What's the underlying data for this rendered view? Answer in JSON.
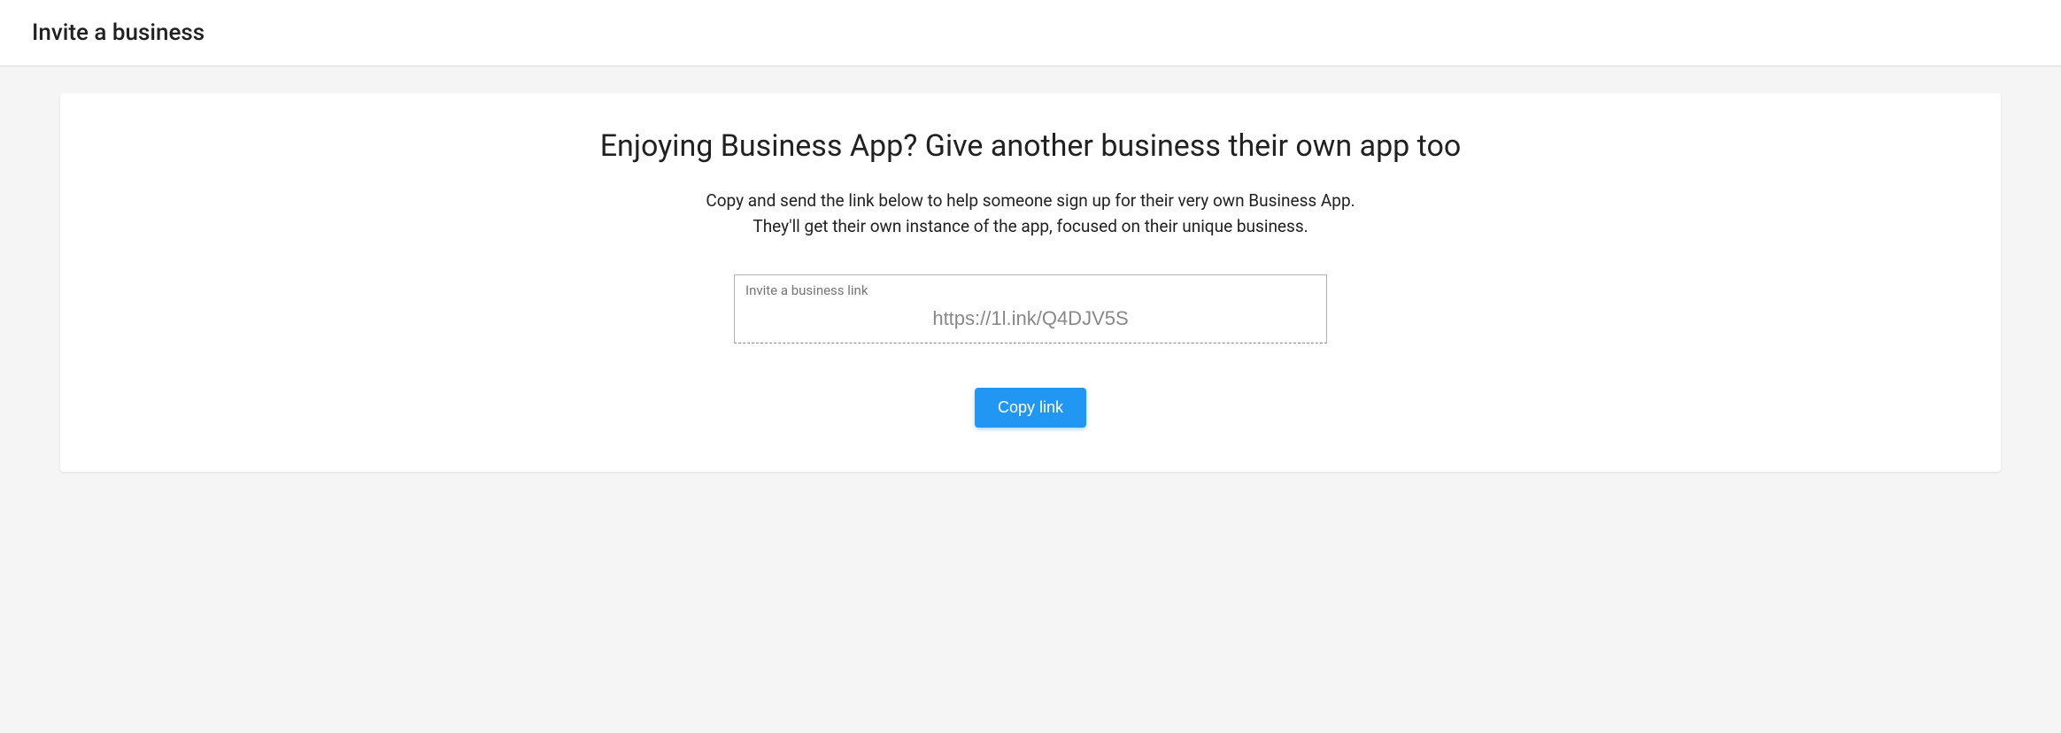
{
  "header": {
    "title": "Invite a business"
  },
  "card": {
    "heading": "Enjoying Business App? Give another business their own app too",
    "description_line1": "Copy and send the link below to help someone sign up for their very own Business App.",
    "description_line2": "They'll get their own instance of the app, focused on their unique business.",
    "input": {
      "label": "Invite a business link",
      "value": "https://1l.ink/Q4DJV5S"
    },
    "copy_button_label": "Copy link"
  }
}
